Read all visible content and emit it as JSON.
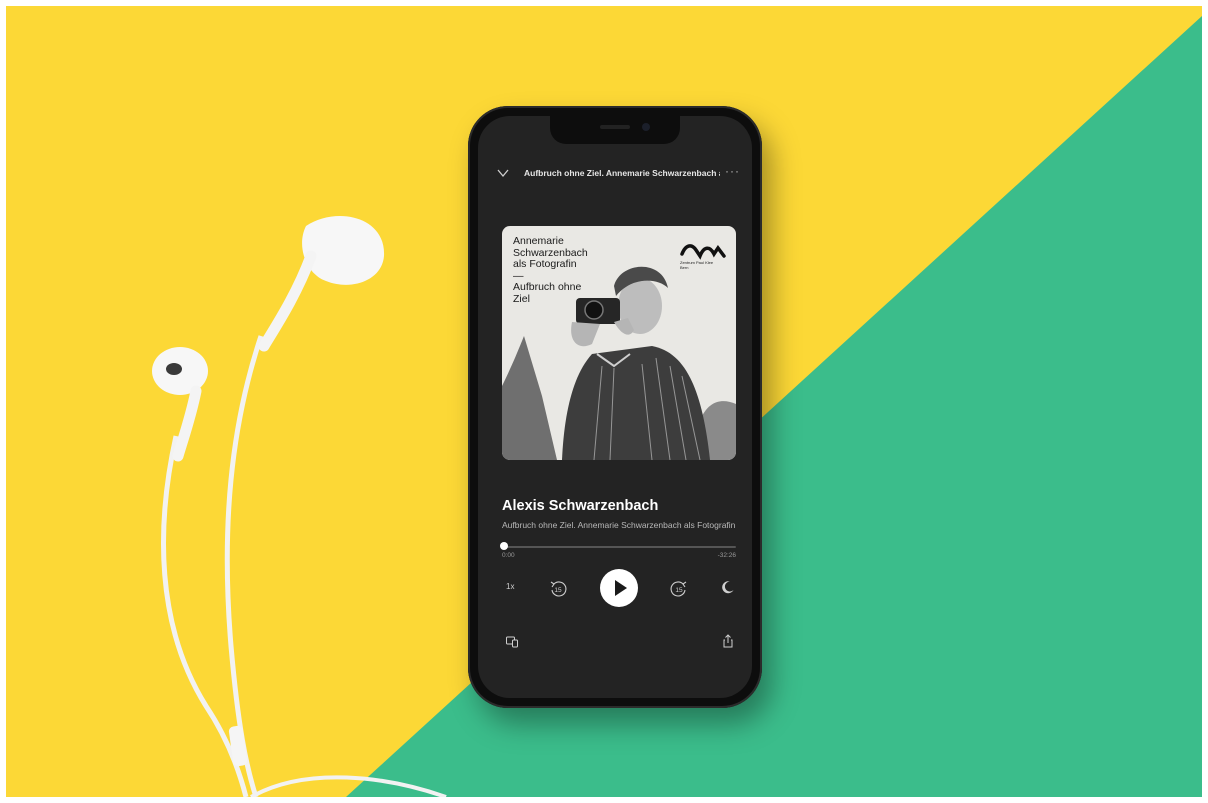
{
  "player": {
    "episode_title": "Aufbruch ohne Ziel. Annemarie Schwarzenbach als Fotografin",
    "more_label": "···",
    "cover": {
      "line1": "Annemarie",
      "line2": "Schwarzenbach",
      "line3": "als Fotografin",
      "dash": "—",
      "line4": "Aufbruch ohne",
      "line5": "Ziel",
      "logo_text1": "Zentrum Paul Klee",
      "logo_text2": "Bern"
    },
    "track_title": "Alexis Schwarzenbach",
    "track_subtitle": "Aufbruch ohne Ziel. Annemarie Schwarzenbach als Fotografin",
    "progress": 0.0,
    "time_elapsed": "0:00",
    "time_remaining": "-32:26",
    "speed_label": "1x",
    "skip_back_seconds": "15",
    "skip_forward_seconds": "15"
  },
  "colors": {
    "background_yellow": "#fcd836",
    "background_green": "#3bbd8b",
    "phone_body": "#0d0d0d",
    "screen_bg": "#232323"
  },
  "icons": [
    "chevron-down-icon",
    "more-icon",
    "play-icon",
    "skip-back-15-icon",
    "skip-forward-15-icon",
    "sleep-timer-moon-icon",
    "devices-icon",
    "share-icon",
    "earphones-icon"
  ]
}
